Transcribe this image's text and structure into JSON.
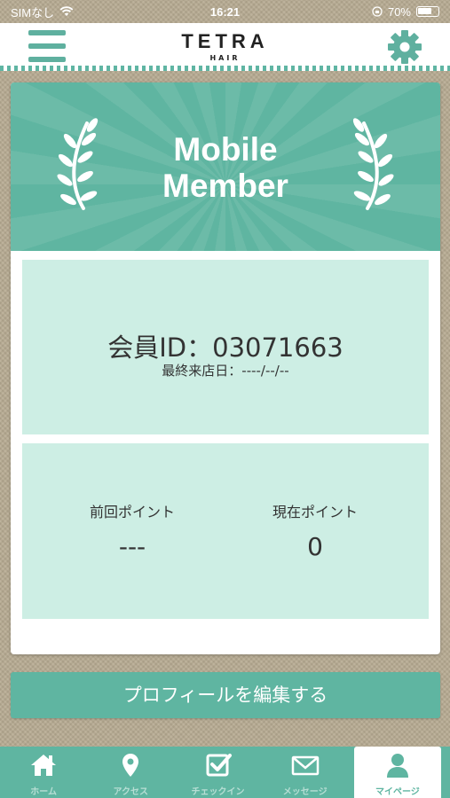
{
  "status_bar": {
    "carrier": "SIMなし",
    "time": "16:21",
    "battery": "70%"
  },
  "header": {
    "logo_main": "TETRA",
    "logo_sub": "HAIR",
    "menu_icon": "hamburger-icon",
    "settings_icon": "gear-icon"
  },
  "banner": {
    "title_line1": "Mobile",
    "title_line2": "Member"
  },
  "member": {
    "id_text": "会員ID：03071663",
    "last_visit_text": "最終来店日：----/--/--"
  },
  "points": {
    "previous_label": "前回ポイント",
    "previous_value": "---",
    "current_label": "現在ポイント",
    "current_value": "0"
  },
  "edit_profile_label": "プロフィールを編集する",
  "tabs": [
    {
      "label": "ホーム",
      "icon": "home-icon"
    },
    {
      "label": "アクセス",
      "icon": "map-pin-icon"
    },
    {
      "label": "チェックイン",
      "icon": "checkbox-icon"
    },
    {
      "label": "メッセージ",
      "icon": "envelope-icon"
    },
    {
      "label": "マイページ",
      "icon": "user-icon",
      "active": true
    }
  ],
  "colors": {
    "accent": "#5fb5a1",
    "panel": "#cdeee4",
    "background": "#b7ab92"
  }
}
